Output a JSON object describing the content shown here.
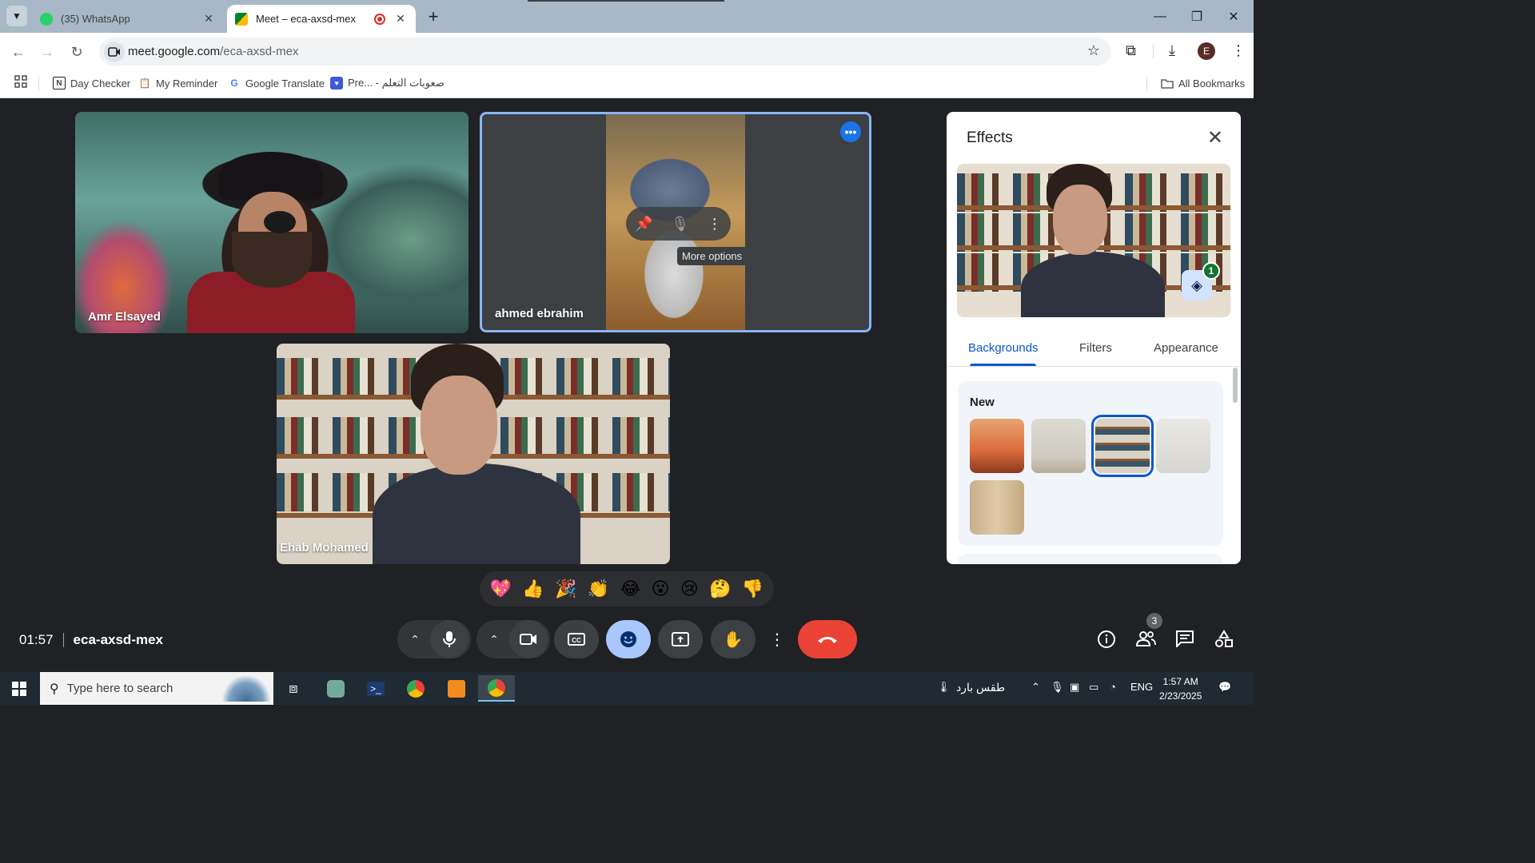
{
  "browser": {
    "tabs": [
      {
        "title": "(35) WhatsApp",
        "favicon": "whatsapp-icon",
        "badge": "35"
      },
      {
        "title": "Meet – eca-axsd-mex",
        "favicon": "google-meet-icon",
        "recording": true
      }
    ],
    "url": {
      "host": "meet.google.com",
      "path": "/eca-axsd-mex"
    },
    "profile_initial": "E",
    "bookmarks": [
      {
        "label": "Day Checker",
        "icon": "notion-icon"
      },
      {
        "label": "My Reminder",
        "icon": "clipboard-icon"
      },
      {
        "label": "Google Translate",
        "icon": "google-icon"
      },
      {
        "label": "Pre... - صعوبات التعلم",
        "icon": "app-icon"
      }
    ],
    "all_bookmarks": "All Bookmarks"
  },
  "meet": {
    "participants": [
      {
        "name": "Amr Elsayed"
      },
      {
        "name": "ahmed ebrahim"
      },
      {
        "name": "Ehab Mohamed"
      }
    ],
    "tooltip": "More options",
    "reactions": [
      "💖",
      "👍",
      "🎉",
      "👏",
      "😂",
      "😮",
      "😢",
      "🤔",
      "👎"
    ],
    "time": "01:57",
    "meeting_code": "eca-axsd-mex",
    "people_count": "3"
  },
  "effects": {
    "title": "Effects",
    "tabs": [
      "Backgrounds",
      "Filters",
      "Appearance"
    ],
    "selected_tab": "Backgrounds",
    "section_title": "New",
    "applied_count": "1"
  },
  "taskbar": {
    "search_placeholder": "Type here to search",
    "weather": "طقس بارد",
    "language": "ENG",
    "time": "1:57 AM",
    "date": "2/23/2025"
  },
  "colors": {
    "accent_blue": "#0b57d0",
    "end_call": "#ea4335",
    "meet_bg": "#202124",
    "highlight_border": "#8ab4f8"
  }
}
